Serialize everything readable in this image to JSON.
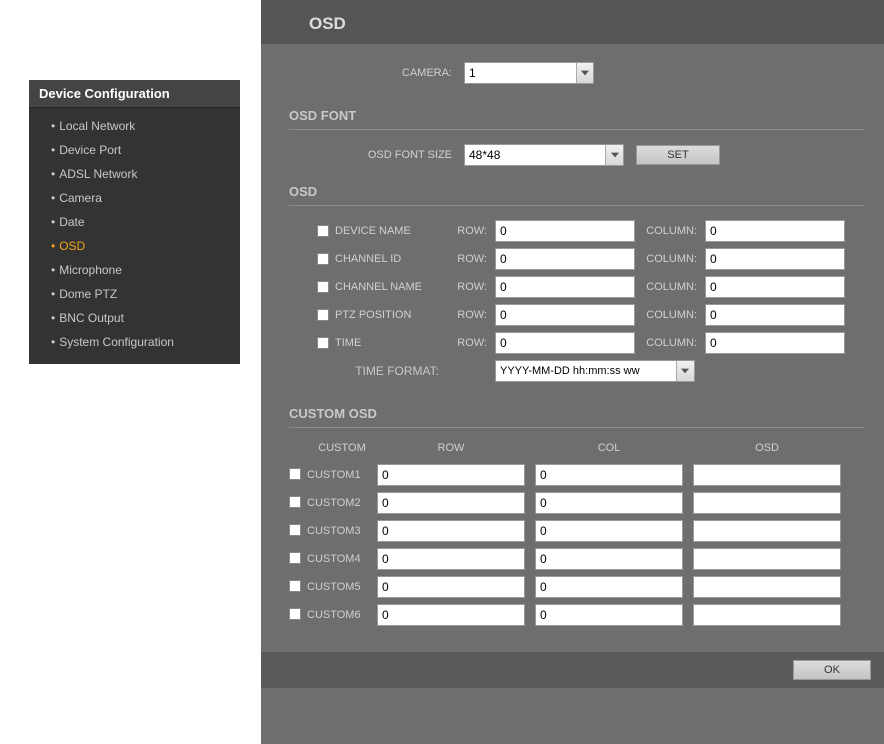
{
  "sidebar": {
    "title": "Device Configuration",
    "items": [
      {
        "label": "Local Network"
      },
      {
        "label": "Device Port"
      },
      {
        "label": "ADSL Network"
      },
      {
        "label": "Camera"
      },
      {
        "label": "Date"
      },
      {
        "label": "OSD",
        "active": true
      },
      {
        "label": "Microphone"
      },
      {
        "label": "Dome PTZ"
      },
      {
        "label": "BNC Output"
      },
      {
        "label": "System Configuration"
      }
    ]
  },
  "page_title": "OSD",
  "camera": {
    "label": "CAMERA:",
    "value": "1"
  },
  "osd_font": {
    "section": "OSD FONT",
    "size_label": "OSD FONT SIZE",
    "size_value": "48*48",
    "set_button": "SET"
  },
  "osd_section": {
    "title": "OSD",
    "rows": [
      {
        "name": "DEVICE NAME",
        "row": "0",
        "col": "0"
      },
      {
        "name": "CHANNEL ID",
        "row": "0",
        "col": "0"
      },
      {
        "name": "CHANNEL NAME",
        "row": "0",
        "col": "0"
      },
      {
        "name": "PTZ POSITION",
        "row": "0",
        "col": "0"
      },
      {
        "name": "TIME",
        "row": "0",
        "col": "0"
      }
    ],
    "row_label": "ROW:",
    "col_label": "COLUMN:",
    "time_format_label": "TIME FORMAT:",
    "time_format_value": "YYYY-MM-DD hh:mm:ss ww"
  },
  "custom_osd": {
    "title": "CUSTOM OSD",
    "head": {
      "custom": "CUSTOM",
      "row": "ROW",
      "col": "COL",
      "osd": "OSD"
    },
    "rows": [
      {
        "name": "CUSTOM1",
        "row": "0",
        "col": "0",
        "osd": ""
      },
      {
        "name": "CUSTOM2",
        "row": "0",
        "col": "0",
        "osd": ""
      },
      {
        "name": "CUSTOM3",
        "row": "0",
        "col": "0",
        "osd": ""
      },
      {
        "name": "CUSTOM4",
        "row": "0",
        "col": "0",
        "osd": ""
      },
      {
        "name": "CUSTOM5",
        "row": "0",
        "col": "0",
        "osd": ""
      },
      {
        "name": "CUSTOM6",
        "row": "0",
        "col": "0",
        "osd": ""
      }
    ]
  },
  "ok_button": "OK"
}
